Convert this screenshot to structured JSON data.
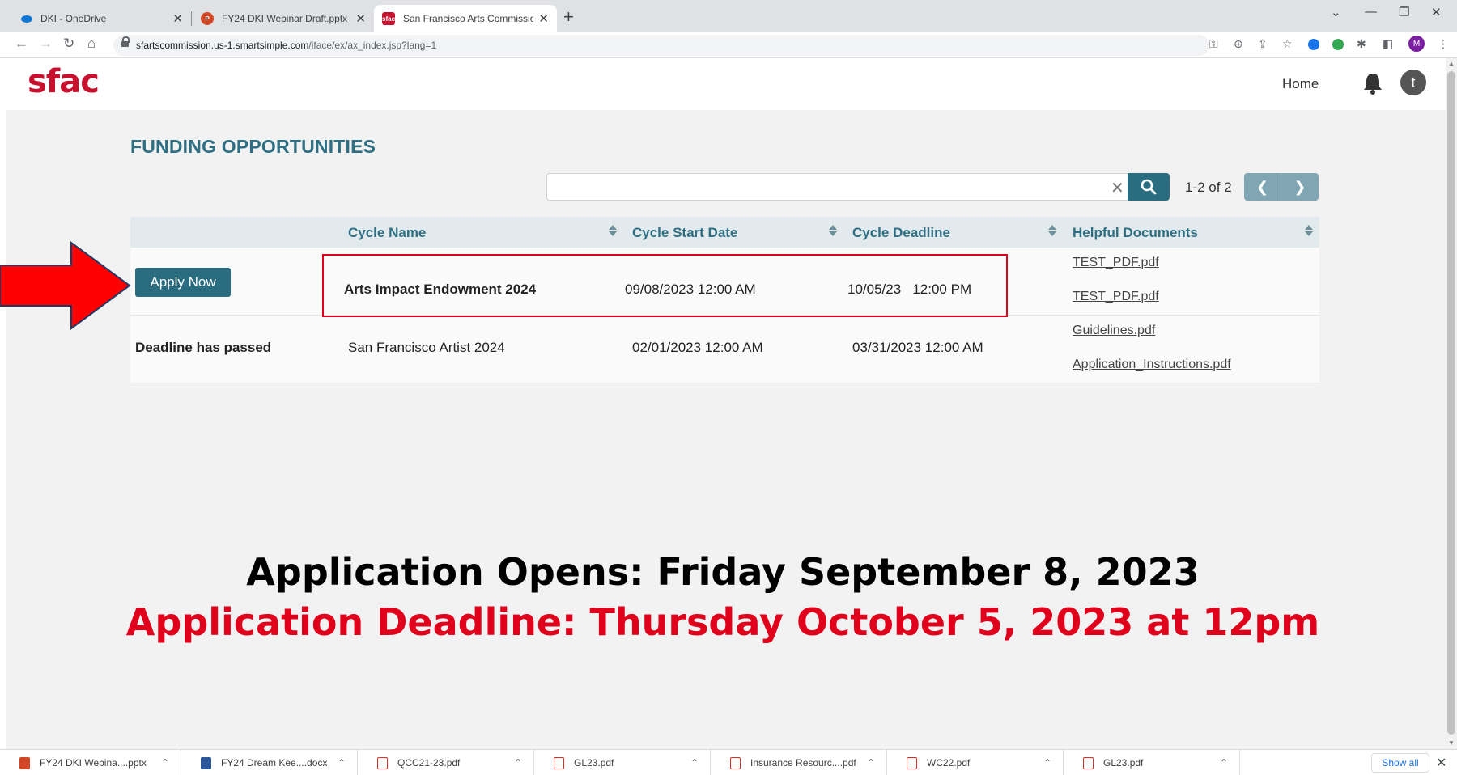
{
  "browser": {
    "tabs": [
      {
        "title": "DKI - OneDrive",
        "icon": "onedrive-icon",
        "active": false
      },
      {
        "title": "FY24 DKI Webinar Draft.pptx",
        "icon": "powerpoint-icon",
        "active": false
      },
      {
        "title": "San Francisco Arts Commission",
        "icon": "sfac-favicon",
        "active": true
      }
    ],
    "url_host": "sfartscommission.us-1.smartsimple.com",
    "url_path": "/iface/ex/ax_index.jsp?lang=1",
    "profile_initial": "M"
  },
  "site": {
    "logo": "sfac",
    "nav_home": "Home",
    "user_initial": "t",
    "brand_color": "#c8102e",
    "accent_color": "#2a6c80"
  },
  "main": {
    "title": "FUNDING OPPORTUNITIES",
    "search_value": "",
    "pager_text": "1-2 of 2",
    "columns": [
      "Cycle Name",
      "Cycle Start Date",
      "Cycle Deadline",
      "Helpful Documents"
    ],
    "rows": [
      {
        "action": "Apply Now",
        "cycle_name": "Arts Impact Endowment 2024",
        "start_date": "09/08/2023 12:00 AM",
        "deadline": "10/05/23   12:00 PM",
        "docs": [
          "TEST_PDF.pdf",
          "TEST_PDF.pdf"
        ]
      },
      {
        "action": "Deadline has passed",
        "cycle_name": "San Francisco Artist 2024",
        "start_date": "02/01/2023 12:00 AM",
        "deadline": "03/31/2023 12:00 AM",
        "docs": [
          "Guidelines.pdf",
          "Application_Instructions.pdf"
        ]
      }
    ]
  },
  "annotation": {
    "opens": "Application Opens: Friday September 8, 2023",
    "deadline": "Application Deadline: Thursday October 5, 2023 at 12pm",
    "highlight_color": "#e0001b"
  },
  "downloads": {
    "items": [
      {
        "name": "FY24 DKI Webina....pptx",
        "type": "ppt"
      },
      {
        "name": "FY24 Dream Kee....docx",
        "type": "doc"
      },
      {
        "name": "QCC21-23.pdf",
        "type": "pdf"
      },
      {
        "name": "GL23.pdf",
        "type": "pdf"
      },
      {
        "name": "Insurance Resourc....pdf",
        "type": "pdf"
      },
      {
        "name": "WC22.pdf",
        "type": "pdf"
      },
      {
        "name": "GL23.pdf",
        "type": "pdf"
      }
    ],
    "show_all": "Show all"
  }
}
